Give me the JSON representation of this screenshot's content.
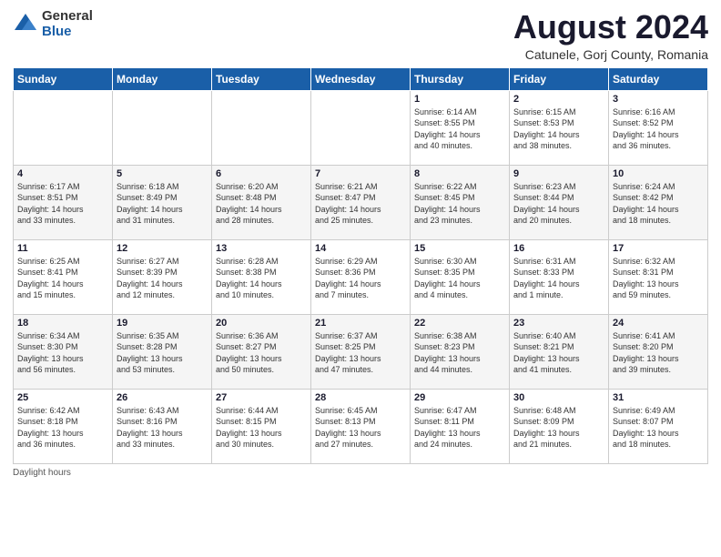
{
  "logo": {
    "general": "General",
    "blue": "Blue"
  },
  "title": "August 2024",
  "subtitle": "Catunele, Gorj County, Romania",
  "weekdays": [
    "Sunday",
    "Monday",
    "Tuesday",
    "Wednesday",
    "Thursday",
    "Friday",
    "Saturday"
  ],
  "weeks": [
    [
      {
        "day": "",
        "info": ""
      },
      {
        "day": "",
        "info": ""
      },
      {
        "day": "",
        "info": ""
      },
      {
        "day": "",
        "info": ""
      },
      {
        "day": "1",
        "info": "Sunrise: 6:14 AM\nSunset: 8:55 PM\nDaylight: 14 hours\nand 40 minutes."
      },
      {
        "day": "2",
        "info": "Sunrise: 6:15 AM\nSunset: 8:53 PM\nDaylight: 14 hours\nand 38 minutes."
      },
      {
        "day": "3",
        "info": "Sunrise: 6:16 AM\nSunset: 8:52 PM\nDaylight: 14 hours\nand 36 minutes."
      }
    ],
    [
      {
        "day": "4",
        "info": "Sunrise: 6:17 AM\nSunset: 8:51 PM\nDaylight: 14 hours\nand 33 minutes."
      },
      {
        "day": "5",
        "info": "Sunrise: 6:18 AM\nSunset: 8:49 PM\nDaylight: 14 hours\nand 31 minutes."
      },
      {
        "day": "6",
        "info": "Sunrise: 6:20 AM\nSunset: 8:48 PM\nDaylight: 14 hours\nand 28 minutes."
      },
      {
        "day": "7",
        "info": "Sunrise: 6:21 AM\nSunset: 8:47 PM\nDaylight: 14 hours\nand 25 minutes."
      },
      {
        "day": "8",
        "info": "Sunrise: 6:22 AM\nSunset: 8:45 PM\nDaylight: 14 hours\nand 23 minutes."
      },
      {
        "day": "9",
        "info": "Sunrise: 6:23 AM\nSunset: 8:44 PM\nDaylight: 14 hours\nand 20 minutes."
      },
      {
        "day": "10",
        "info": "Sunrise: 6:24 AM\nSunset: 8:42 PM\nDaylight: 14 hours\nand 18 minutes."
      }
    ],
    [
      {
        "day": "11",
        "info": "Sunrise: 6:25 AM\nSunset: 8:41 PM\nDaylight: 14 hours\nand 15 minutes."
      },
      {
        "day": "12",
        "info": "Sunrise: 6:27 AM\nSunset: 8:39 PM\nDaylight: 14 hours\nand 12 minutes."
      },
      {
        "day": "13",
        "info": "Sunrise: 6:28 AM\nSunset: 8:38 PM\nDaylight: 14 hours\nand 10 minutes."
      },
      {
        "day": "14",
        "info": "Sunrise: 6:29 AM\nSunset: 8:36 PM\nDaylight: 14 hours\nand 7 minutes."
      },
      {
        "day": "15",
        "info": "Sunrise: 6:30 AM\nSunset: 8:35 PM\nDaylight: 14 hours\nand 4 minutes."
      },
      {
        "day": "16",
        "info": "Sunrise: 6:31 AM\nSunset: 8:33 PM\nDaylight: 14 hours\nand 1 minute."
      },
      {
        "day": "17",
        "info": "Sunrise: 6:32 AM\nSunset: 8:31 PM\nDaylight: 13 hours\nand 59 minutes."
      }
    ],
    [
      {
        "day": "18",
        "info": "Sunrise: 6:34 AM\nSunset: 8:30 PM\nDaylight: 13 hours\nand 56 minutes."
      },
      {
        "day": "19",
        "info": "Sunrise: 6:35 AM\nSunset: 8:28 PM\nDaylight: 13 hours\nand 53 minutes."
      },
      {
        "day": "20",
        "info": "Sunrise: 6:36 AM\nSunset: 8:27 PM\nDaylight: 13 hours\nand 50 minutes."
      },
      {
        "day": "21",
        "info": "Sunrise: 6:37 AM\nSunset: 8:25 PM\nDaylight: 13 hours\nand 47 minutes."
      },
      {
        "day": "22",
        "info": "Sunrise: 6:38 AM\nSunset: 8:23 PM\nDaylight: 13 hours\nand 44 minutes."
      },
      {
        "day": "23",
        "info": "Sunrise: 6:40 AM\nSunset: 8:21 PM\nDaylight: 13 hours\nand 41 minutes."
      },
      {
        "day": "24",
        "info": "Sunrise: 6:41 AM\nSunset: 8:20 PM\nDaylight: 13 hours\nand 39 minutes."
      }
    ],
    [
      {
        "day": "25",
        "info": "Sunrise: 6:42 AM\nSunset: 8:18 PM\nDaylight: 13 hours\nand 36 minutes."
      },
      {
        "day": "26",
        "info": "Sunrise: 6:43 AM\nSunset: 8:16 PM\nDaylight: 13 hours\nand 33 minutes."
      },
      {
        "day": "27",
        "info": "Sunrise: 6:44 AM\nSunset: 8:15 PM\nDaylight: 13 hours\nand 30 minutes."
      },
      {
        "day": "28",
        "info": "Sunrise: 6:45 AM\nSunset: 8:13 PM\nDaylight: 13 hours\nand 27 minutes."
      },
      {
        "day": "29",
        "info": "Sunrise: 6:47 AM\nSunset: 8:11 PM\nDaylight: 13 hours\nand 24 minutes."
      },
      {
        "day": "30",
        "info": "Sunrise: 6:48 AM\nSunset: 8:09 PM\nDaylight: 13 hours\nand 21 minutes."
      },
      {
        "day": "31",
        "info": "Sunrise: 6:49 AM\nSunset: 8:07 PM\nDaylight: 13 hours\nand 18 minutes."
      }
    ]
  ],
  "footer": "Daylight hours"
}
